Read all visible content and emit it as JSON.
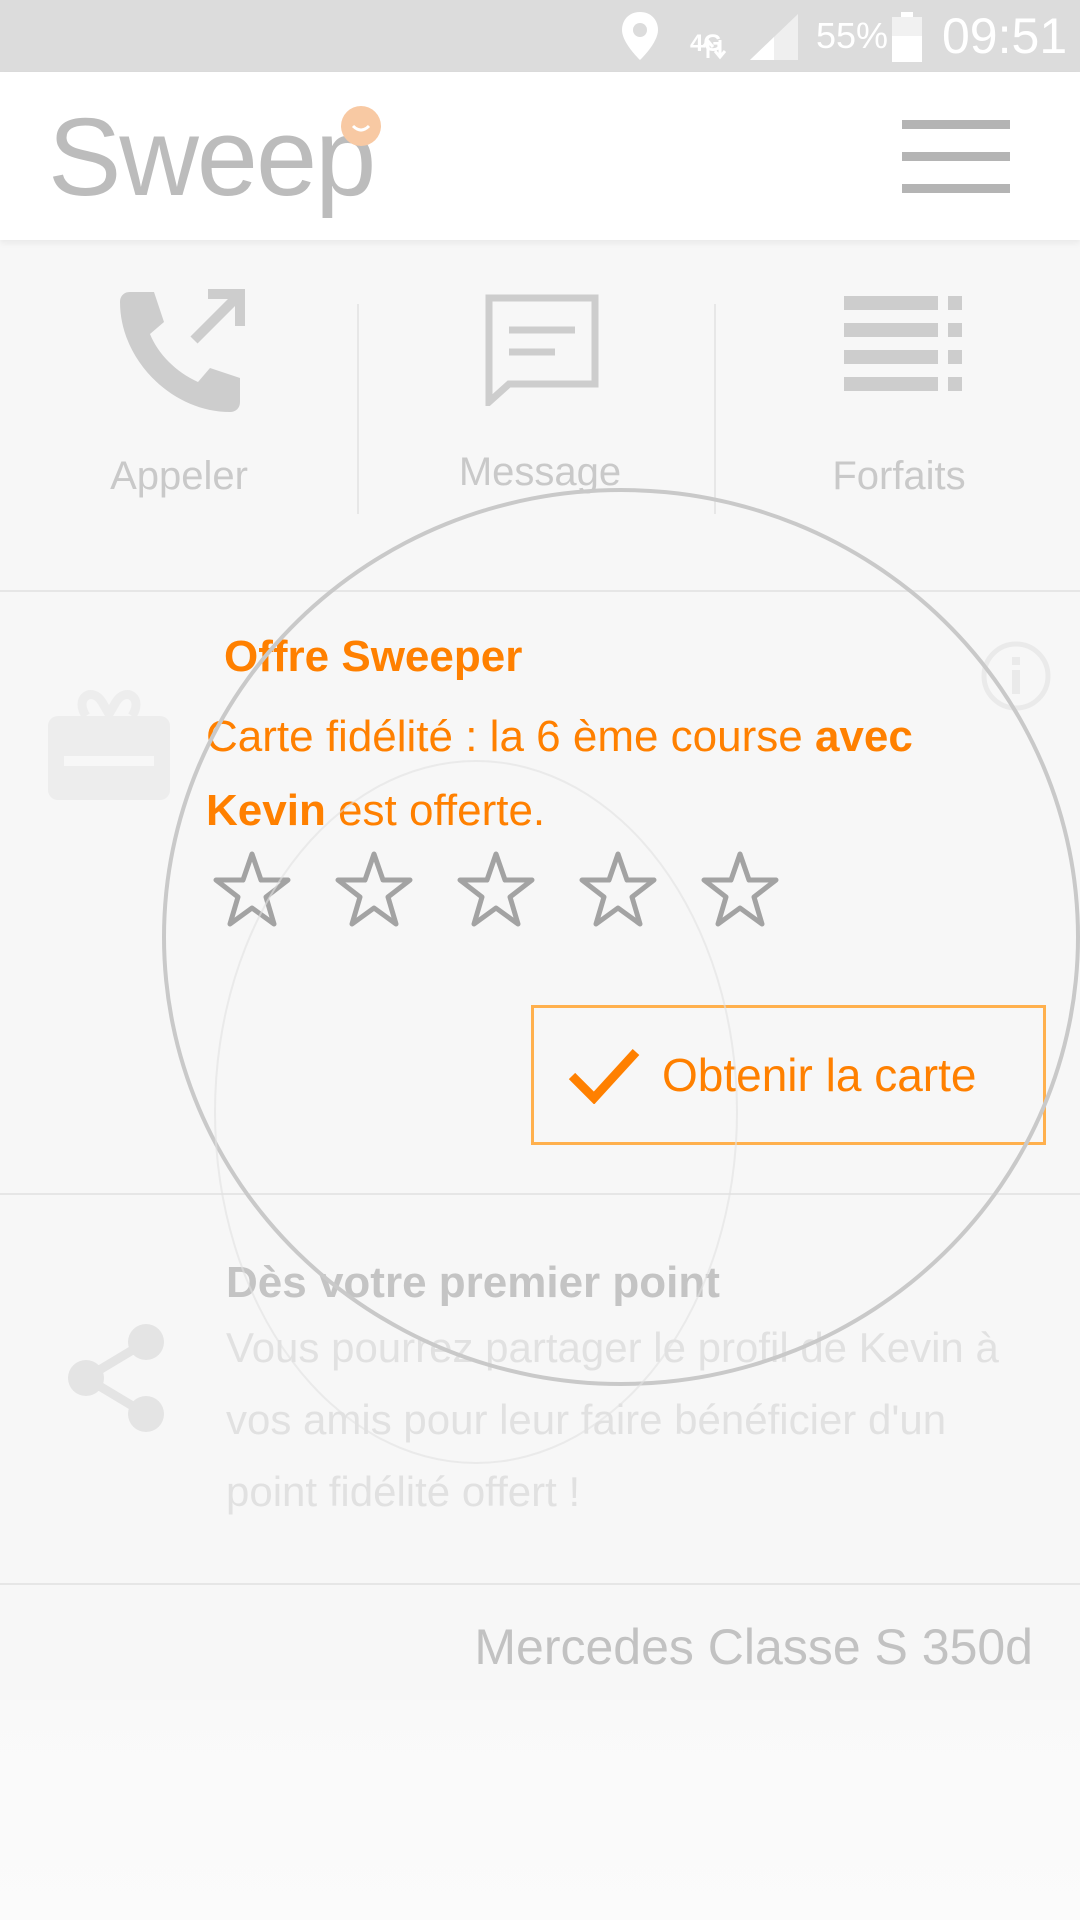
{
  "status_bar": {
    "network": "4G",
    "battery": "55%",
    "time": "09:51",
    "icons": [
      "location-icon",
      "network-arrows-icon",
      "signal-icon",
      "battery-icon"
    ]
  },
  "app_bar": {
    "logo": "Sweep",
    "menu_icon": "hamburger-icon"
  },
  "actions": [
    {
      "label": "Appeler",
      "icon": "phone-outgoing-icon"
    },
    {
      "label": "Message",
      "icon": "message-icon"
    },
    {
      "label": "Forfaits",
      "icon": "list-icon"
    }
  ],
  "offer": {
    "title": "Offre Sweeper",
    "body_prefix": "Carte fidélité : la 6 ème course ",
    "body_bold": "avec Kevin",
    "body_suffix": " est offerte.",
    "stars_filled": 0,
    "stars_total": 5,
    "button_label": "Obtenir la carte",
    "icons": [
      "gift-icon",
      "info-icon",
      "check-icon",
      "star-icon"
    ]
  },
  "share": {
    "title": "Dès votre premier point",
    "body": "Vous pourrez partager le profil de Kevin à vos amis pour leur faire bénéficier d'un point fidélité offert !",
    "icon": "share-icon"
  },
  "vehicle": {
    "name": "Mercedes Classe S 350d"
  },
  "colors": {
    "accent": "#ff8000",
    "accent_light": "#ffb04d",
    "logo_dot": "#f8c9a3",
    "muted_text": "#c9c9c9",
    "status_bar": "#dcdcdc"
  }
}
